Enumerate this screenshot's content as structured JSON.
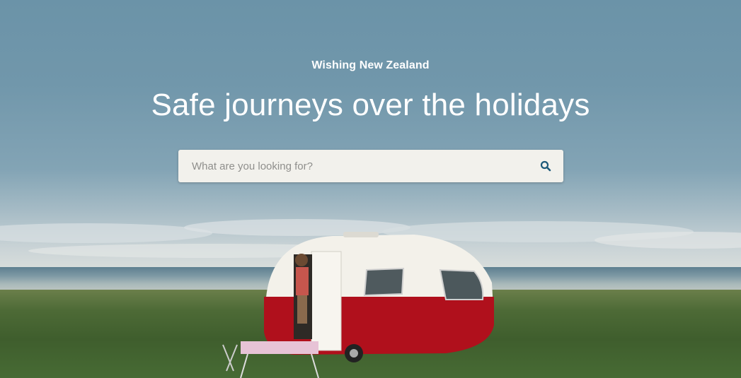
{
  "hero": {
    "eyebrow": "Wishing New Zealand",
    "headline": "Safe journeys over the holidays"
  },
  "search": {
    "placeholder": "What are you looking for?",
    "button_icon": "search-icon"
  },
  "colors": {
    "sky": "#6b93a8",
    "search_bg": "#f2f1ec",
    "search_icon": "#1d5a7a",
    "caravan_red": "#b0101c"
  }
}
